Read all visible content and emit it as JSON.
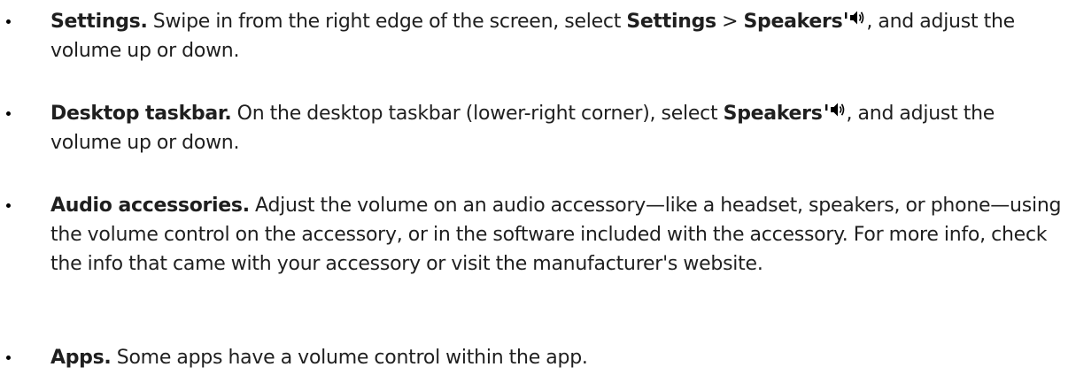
{
  "items": [
    {
      "title": "Settings.",
      "t1": " Swipe in from the right edge of the screen, select ",
      "b1": "Settings",
      "t2": " > ",
      "b2": "Speakers",
      "icon": "speaker-volume-icon",
      "t3": ", and adjust the volume up or down."
    },
    {
      "title": "Desktop taskbar.",
      "t1": " On the desktop taskbar (lower-right corner), select ",
      "b1": "Speakers",
      "icon": "speaker-volume-icon",
      "t2": ", and adjust the volume up or down."
    },
    {
      "title": "Audio accessories.",
      "t1": " Adjust the volume on an audio accessory—like a headset, speakers, or phone—using the volume control on the accessory, or in the software included with the accessory. For more info, check the info that came with your accessory or visit the manufacturer's website."
    },
    {
      "title": "Apps.",
      "t1": " Some apps have a volume control within the app."
    }
  ]
}
